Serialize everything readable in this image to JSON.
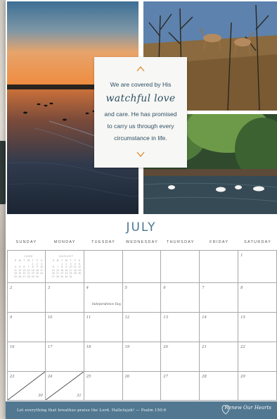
{
  "quote": {
    "line1": "We are covered by His",
    "script": "watchful love",
    "line2": "and care. He has promised",
    "line3": "to carry us through every",
    "line4": "circumstance in life."
  },
  "month": "JULY",
  "weekdays": [
    "SUNDAY",
    "MONDAY",
    "TUESDAY",
    "WEDNESDAY",
    "THURSDAY",
    "FRIDAY",
    "SATURDAY"
  ],
  "weeks": [
    [
      "",
      "",
      "",
      "",
      "",
      "",
      "1"
    ],
    [
      "2",
      "3",
      "4",
      "5",
      "6",
      "7",
      "8"
    ],
    [
      "9",
      "10",
      "11",
      "12",
      "13",
      "14",
      "15"
    ],
    [
      "16",
      "17",
      "18",
      "19",
      "20",
      "21",
      "22"
    ],
    [
      "23",
      "24",
      "25",
      "26",
      "27",
      "28",
      "29"
    ]
  ],
  "split_days": {
    "sunday_bottom": "30",
    "monday_bottom": "31"
  },
  "holiday": {
    "label": "Independence Day"
  },
  "mini_calendars": [
    {
      "name": "JUNE",
      "weekday_initials": [
        "S",
        "M",
        "T",
        "W",
        "T",
        "F",
        "S"
      ],
      "rows": [
        [
          "",
          "",
          "",
          "",
          "1",
          "2",
          "3"
        ],
        [
          "4",
          "5",
          "6",
          "7",
          "8",
          "9",
          "10"
        ],
        [
          "11",
          "12",
          "13",
          "14",
          "15",
          "16",
          "17"
        ],
        [
          "18",
          "19",
          "20",
          "21",
          "22",
          "23",
          "24"
        ],
        [
          "25",
          "26",
          "27",
          "28",
          "29",
          "30",
          ""
        ]
      ]
    },
    {
      "name": "AUGUST",
      "weekday_initials": [
        "S",
        "M",
        "T",
        "W",
        "T",
        "F",
        "S"
      ],
      "rows": [
        [
          "",
          "",
          "1",
          "2",
          "3",
          "4",
          "5"
        ],
        [
          "6",
          "7",
          "8",
          "9",
          "10",
          "11",
          "12"
        ],
        [
          "13",
          "14",
          "15",
          "16",
          "17",
          "18",
          "19"
        ],
        [
          "20",
          "21",
          "22",
          "23",
          "24",
          "25",
          "26"
        ],
        [
          "27",
          "28",
          "29",
          "30",
          "31",
          "",
          ""
        ]
      ]
    }
  ],
  "footer": {
    "verse": "Let everything that breathes praise the Lord. Hallelujah! — Psalm 150:6",
    "brand": "Renew Our Hearts"
  },
  "colors": {
    "accent": "#4c7690",
    "footer_bg": "#527891",
    "quote_text": "#2e4f63",
    "chevron": "#e08a2c",
    "grid_line": "#a8a8a8"
  },
  "icons": {
    "chevron_up": "chevron-up-icon",
    "chevron_down": "chevron-down-icon",
    "brand_mark": "brand-logo-icon"
  }
}
